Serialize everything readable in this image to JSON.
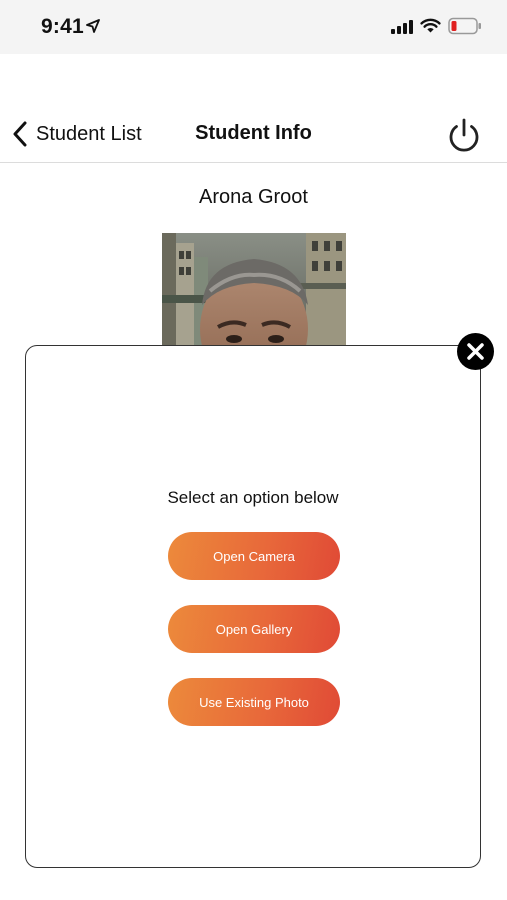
{
  "status_bar": {
    "time": "9:41",
    "icons": [
      "location-arrow-icon",
      "cellular-signal-icon",
      "wifi-icon",
      "battery-low-icon"
    ],
    "battery_color": "#e02020"
  },
  "nav": {
    "back_label": "Student List",
    "title": "Student Info",
    "back_icon": "chevron-left-icon",
    "power_icon": "power-icon"
  },
  "student": {
    "name": "Arona Groot"
  },
  "modal": {
    "prompt": "Select an option below",
    "close_icon": "close-icon",
    "options": [
      {
        "label": "Open Camera"
      },
      {
        "label": "Open Gallery"
      },
      {
        "label": "Use Existing Photo"
      }
    ],
    "button_gradient": [
      "#ec8a3b",
      "#e04a36"
    ]
  }
}
